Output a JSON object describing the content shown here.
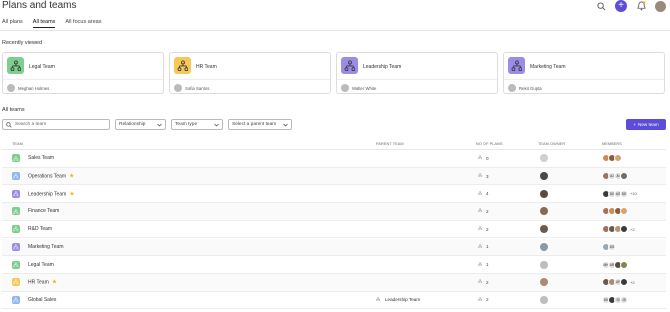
{
  "page": {
    "title": "Plans and teams"
  },
  "tabs": [
    {
      "label": "All plans",
      "active": false
    },
    {
      "label": "All teams",
      "active": true
    },
    {
      "label": "All focus areas",
      "active": false
    }
  ],
  "recently_viewed": {
    "heading": "Recently viewed",
    "cards": [
      {
        "name": "Legal Team",
        "owner": "Meghan Holmes",
        "color": "#7ccf8c"
      },
      {
        "name": "HR Team",
        "owner": "Sofia Santos",
        "color": "#f6c85a"
      },
      {
        "name": "Leadership Team",
        "owner": "Walter White",
        "color": "#9b8ce8"
      },
      {
        "name": "Marketing Team",
        "owner": "Rekit Gupta",
        "color": "#9b8ce8"
      }
    ]
  },
  "all_teams": {
    "heading": "All teams",
    "search_placeholder": "Search a team",
    "filters": [
      "Relationship",
      "Team type",
      "Select a parent team"
    ],
    "new_team_label": "New team",
    "columns": [
      "TEAM",
      "PARENT TEAM",
      "NO OF PLANS",
      "TEAM OWNER",
      "MEMBERS"
    ],
    "rows": [
      {
        "name": "Sales Team",
        "starred": false,
        "color": "#7ccf8c",
        "parent": "",
        "plans": "0",
        "owner_color": "#cfcfcf",
        "members": [
          "#c98b5a",
          "#8a5a3c",
          "#d9a070"
        ],
        "more": ""
      },
      {
        "name": "Operations Team",
        "starred": true,
        "color": "#8fb6f0",
        "parent": "",
        "plans": "3",
        "owner_color": "#4a4a4a",
        "members": [
          "#a07060",
          "AJ",
          "AI",
          "#7a6a5a"
        ],
        "more": ""
      },
      {
        "name": "Leadership Team",
        "starred": true,
        "color": "#9b8ce8",
        "parent": "",
        "plans": "4",
        "owner_color": "#5a4a40",
        "members": [
          "#3a3a3a",
          "DK",
          "AG",
          "DE"
        ],
        "more": "+10"
      },
      {
        "name": "Finance Team",
        "starred": false,
        "color": "#7ccf8c",
        "parent": "",
        "plans": "2",
        "owner_color": "#8a6a50",
        "members": [
          "#b07050",
          "#c98b5a",
          "#8a5a3c",
          "#d9a070"
        ],
        "more": ""
      },
      {
        "name": "R&D Team",
        "starred": false,
        "color": "#7ccf8c",
        "parent": "",
        "plans": "2",
        "owner_color": "#6a5a50",
        "members": [
          "#a07060",
          "#6a5a50",
          "#c09070",
          "#3a3a3a"
        ],
        "more": "+2"
      },
      {
        "name": "Marketing Team",
        "starred": false,
        "color": "#9b8ce8",
        "parent": "",
        "plans": "1",
        "owner_color": "#8a9aa8",
        "members": [
          "#9aa8b0",
          "DS"
        ],
        "more": ""
      },
      {
        "name": "Legal Team",
        "starred": false,
        "color": "#7ccf8c",
        "parent": "",
        "plans": "1",
        "owner_color": "#bdbdbd",
        "members": [
          "MH",
          "AR",
          "#5a4a40",
          "#7a8a50"
        ],
        "more": ""
      },
      {
        "name": "HR Team",
        "starred": true,
        "color": "#f6c85a",
        "parent": "",
        "plans": "2",
        "owner_color": "#b08a70",
        "members": [
          "#6a5a50",
          "#b08a70",
          "AF",
          "#3a3a3a"
        ],
        "more": "+2"
      },
      {
        "name": "Global Sales",
        "starred": false,
        "color": "#8fb6f0",
        "parent": "Leadership Team",
        "plans": "2",
        "owner_color": "#bdbdbd",
        "members": [
          "DK",
          "#3a3a3a",
          "SI",
          "JS"
        ],
        "more": ""
      }
    ]
  }
}
